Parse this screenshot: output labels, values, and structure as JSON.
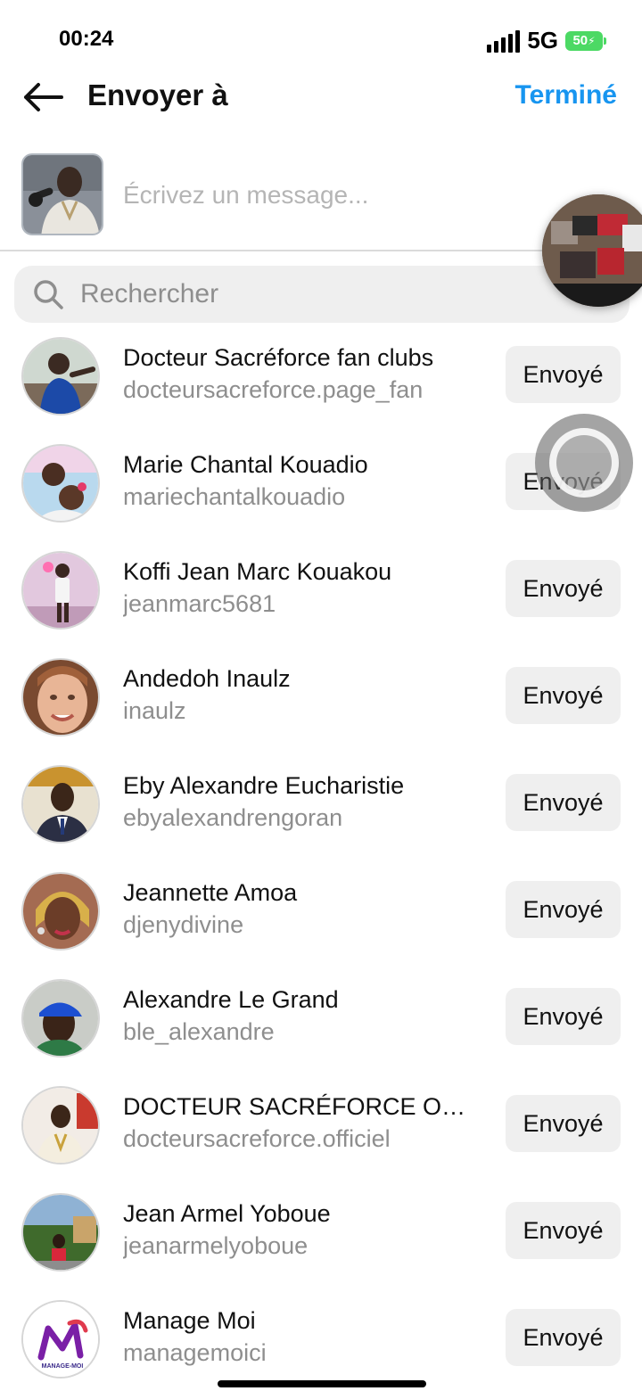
{
  "status_bar": {
    "time": "00:24",
    "network": "5G",
    "battery": "50"
  },
  "header": {
    "title": "Envoyer à",
    "done_label": "Terminé"
  },
  "composer": {
    "placeholder": "Écrivez un message..."
  },
  "search": {
    "placeholder": "Rechercher"
  },
  "contacts": [
    {
      "name": "Docteur Sacréforce fan clubs",
      "username": "docteursacreforce.page_fan",
      "button": "Envoyé"
    },
    {
      "name": "Marie Chantal Kouadio",
      "username": "mariechantalkouadio",
      "button": "Envoyé"
    },
    {
      "name": "Koffi Jean Marc Kouakou",
      "username": "jeanmarc5681",
      "button": "Envoyé"
    },
    {
      "name": "Andedoh Inaulz",
      "username": "inaulz",
      "button": "Envoyé"
    },
    {
      "name": "Eby Alexandre Eucharistie",
      "username": "ebyalexandrengoran",
      "button": "Envoyé"
    },
    {
      "name": "Jeannette Amoa",
      "username": "djenydivine",
      "button": "Envoyé"
    },
    {
      "name": "Alexandre Le Grand",
      "username": "ble_alexandre",
      "button": "Envoyé"
    },
    {
      "name": "DOCTEUR SACRÉFORCE OFFICIEL",
      "username": "docteursacreforce.officiel",
      "button": "Envoyé"
    },
    {
      "name": "Jean Armel Yoboue",
      "username": "jeanarmelyoboue",
      "button": "Envoyé"
    },
    {
      "name": "Manage Moi",
      "username": "managemoici",
      "button": "Envoyé"
    }
  ],
  "colors": {
    "accent": "#1795f0",
    "battery": "#4cd964",
    "button_bg": "#efefef",
    "muted_text": "#8e8e8e"
  },
  "logo_text": "MANAGE-MOI"
}
